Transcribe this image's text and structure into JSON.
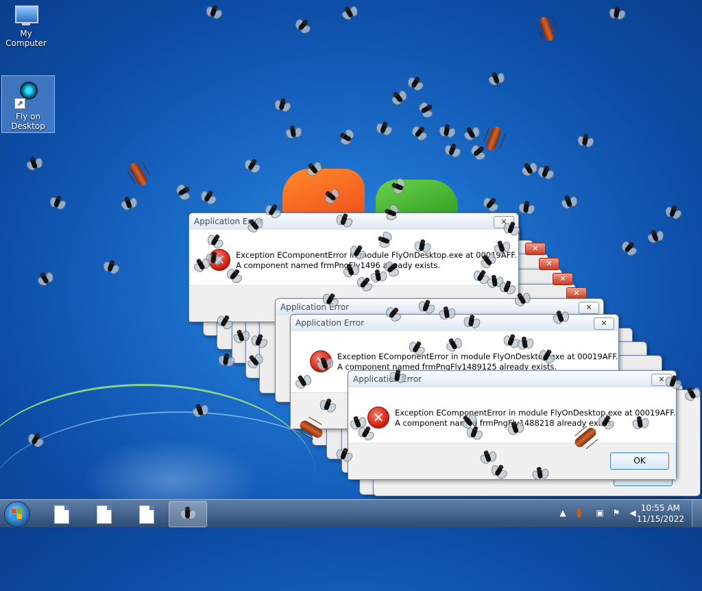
{
  "desktop": {
    "icons": [
      {
        "label": "My Computer"
      },
      {
        "label": "Fly on\nDesktop"
      }
    ]
  },
  "dialogs": {
    "title": "Application Error",
    "close_glyph": "✕",
    "ok_label": "OK",
    "ok_label_partial": "OK",
    "top": {
      "line1": "Exception EComponentError in module FlyOnDesktop.exe at 00019AFF.",
      "line2": "A component named frmPngFly1496 already exists."
    },
    "middle": {
      "line1": "Exception EComponentError in module FlyOnDesktop.exe at 00019AFF.",
      "line2": "A component named frmPngFly1489125 already exists."
    },
    "front": {
      "line1": "Exception EComponentError in module FlyOnDesktop.exe at 00019AFF.",
      "line2": "A component named frmPngFly1488218 already exists."
    }
  },
  "taskbar": {
    "clock_time": "10:55 AM",
    "clock_date": "11/15/2022",
    "tray_icons": [
      "show-hidden-icons-arrow",
      "roach-tray-icon",
      "network-icon",
      "action-center-icon",
      "volume-icon"
    ],
    "pinned": [
      "document-icon",
      "document-icon",
      "document-icon",
      "fly-app-icon"
    ]
  },
  "colors": {
    "wallpaper": "#1a6cc8",
    "error_red": "#c8190a",
    "taskbar": "#3e5f88"
  }
}
